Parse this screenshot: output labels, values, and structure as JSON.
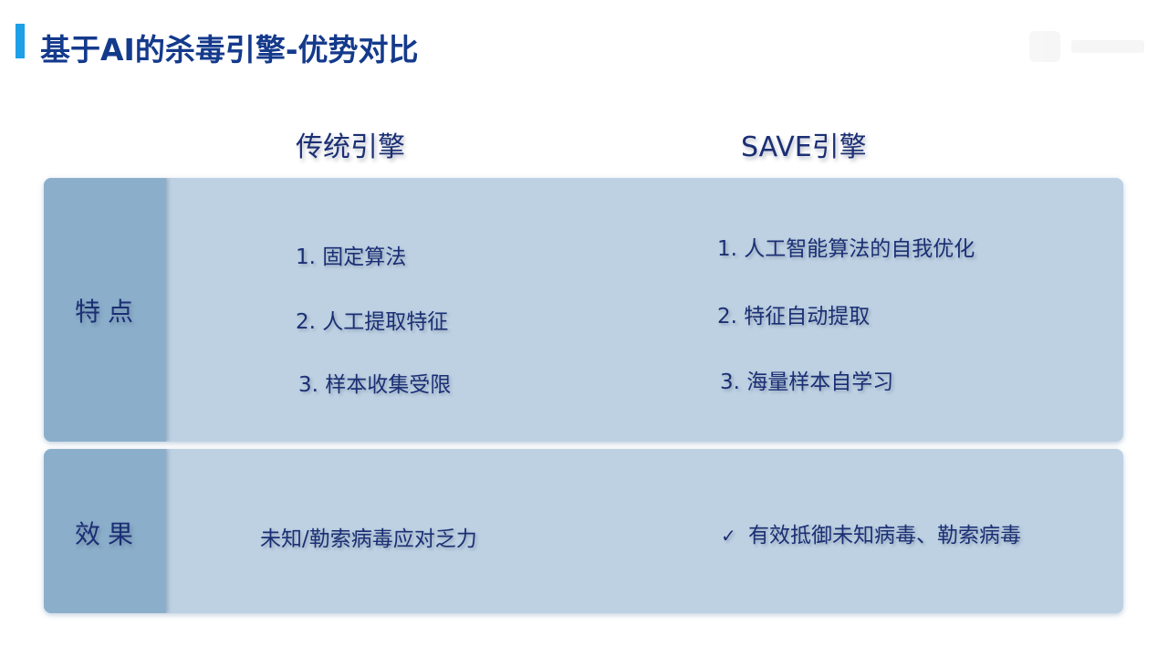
{
  "slide": {
    "title": "基于AI的杀毒引擎-优势对比"
  },
  "columns": {
    "left": "传统引擎",
    "right": "SAVE引擎"
  },
  "features": {
    "label": "特点",
    "traditional": [
      "1. 固定算法",
      "2. 人工提取特征",
      "3. 样本收集受限"
    ],
    "save": [
      "1. 人工智能算法的自我优化",
      "2. 特征自动提取",
      "3. 海量样本自学习"
    ]
  },
  "effects": {
    "label": "效果",
    "traditional": "未知/勒索病毒应对乏力",
    "save": "有效抵御未知病毒、勒索病毒",
    "save_icon": "checkmark-icon"
  },
  "colors": {
    "accent": "#1e9fe6",
    "title": "#143a8c",
    "text": "#1b2f74",
    "panel": "#bdd1e3",
    "label_column": "#8bafcb"
  }
}
